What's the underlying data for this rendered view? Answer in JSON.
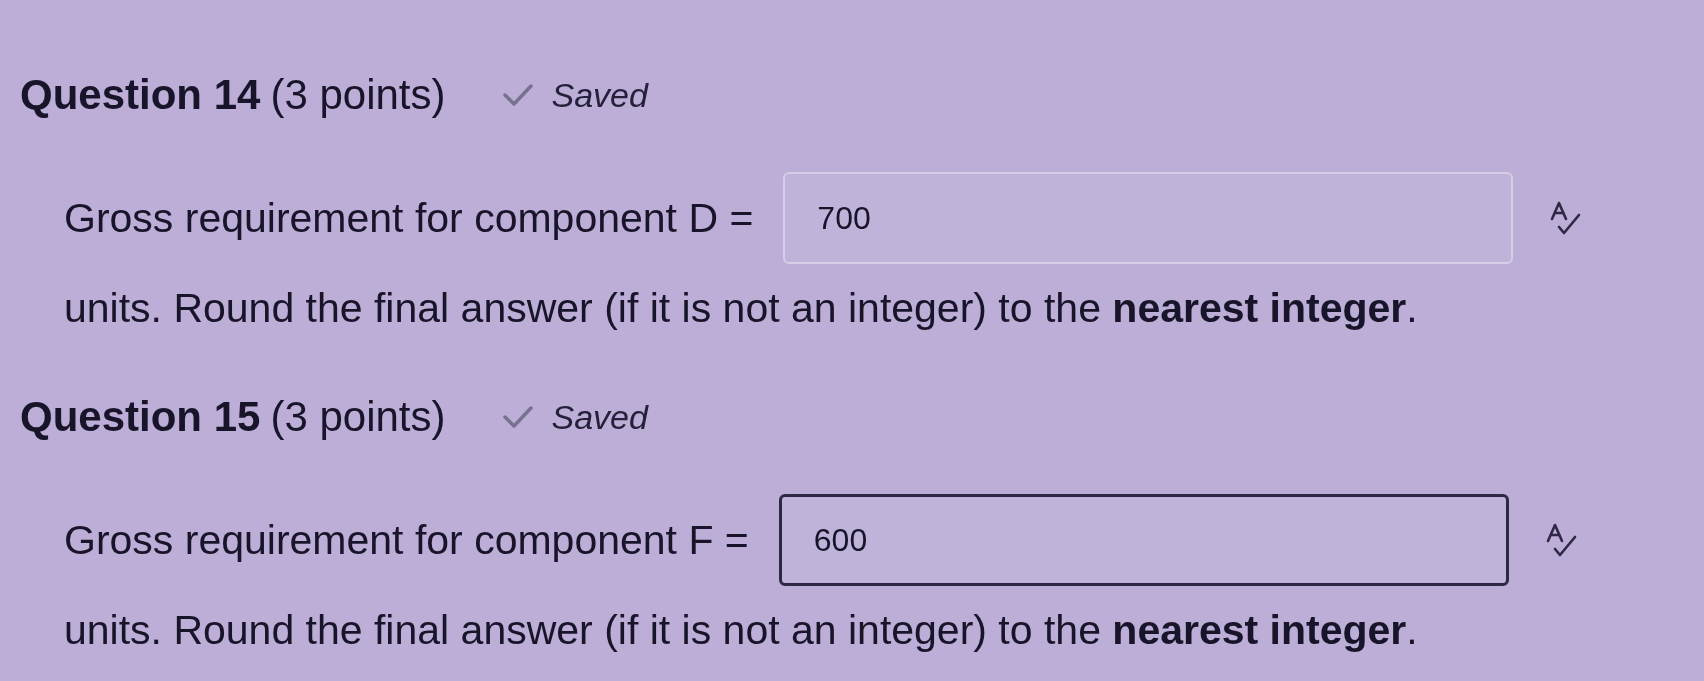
{
  "questions": [
    {
      "title": "Question 14",
      "points": "(3 points)",
      "status": "Saved",
      "prompt": "Gross requirement for component D =",
      "answer": {
        "value": "700",
        "focused": false
      },
      "instruction": "units. Round the final answer (if it is not an integer) to the **nearest integer**."
    },
    {
      "title": "Question 15",
      "points": "(3 points)",
      "status": "Saved",
      "prompt": "Gross requirement for component F =",
      "answer": {
        "value": "600",
        "focused": true
      },
      "instruction": "units. Round the final answer (if it is not an integer) to the **nearest integer**."
    }
  ]
}
